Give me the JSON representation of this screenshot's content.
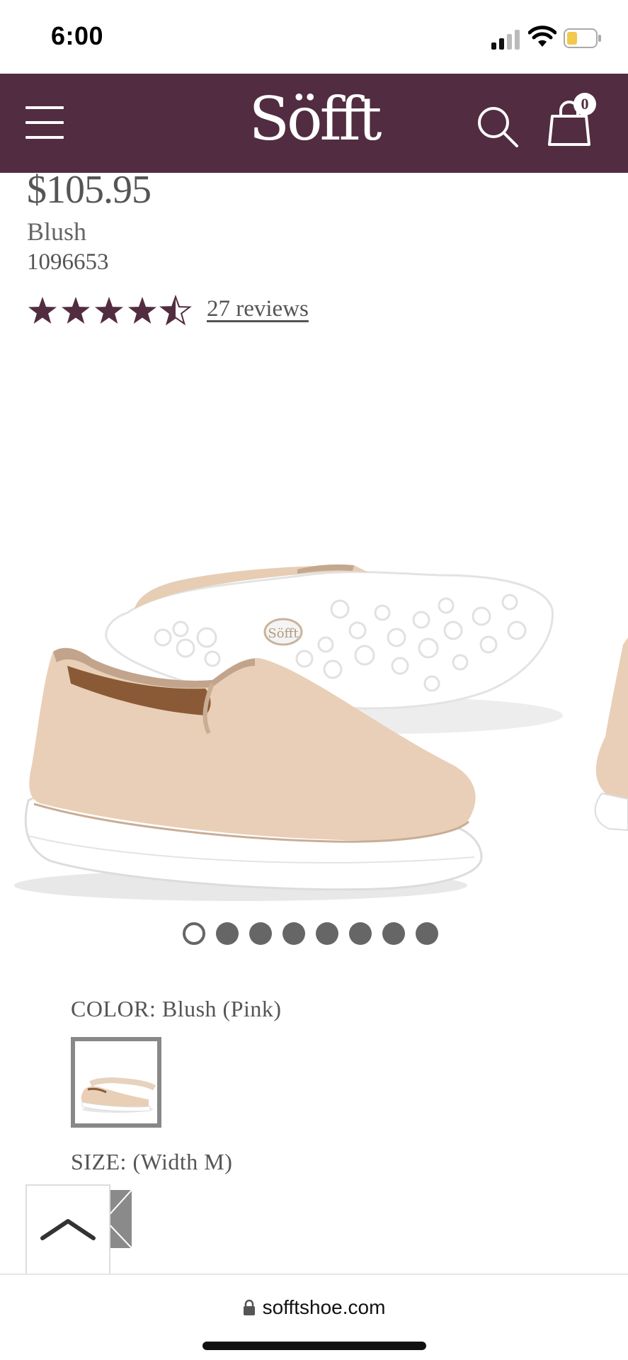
{
  "status_bar": {
    "time": "6:00"
  },
  "header": {
    "logo": "Söfft",
    "cart_count": "0",
    "background": "#522c40"
  },
  "product": {
    "price": "$105.95",
    "color_name": "Blush",
    "sku": "1096653",
    "rating": 4.5,
    "rating_max": 5,
    "reviews_label": "27 reviews",
    "image": {
      "sole_logo": "Söfft"
    }
  },
  "carousel": {
    "count": 8,
    "active_index": 0
  },
  "options": {
    "color_label": "COLOR: Blush (Pink)",
    "size_label": "SIZE:  (Width M)"
  },
  "browser": {
    "url": "sofftshoe.com"
  },
  "icons": {
    "menu": "hamburger-icon",
    "search": "search-icon",
    "cart": "shopping-bag-icon",
    "back_to_top": "chevron-up-icon",
    "lock": "lock-icon"
  }
}
